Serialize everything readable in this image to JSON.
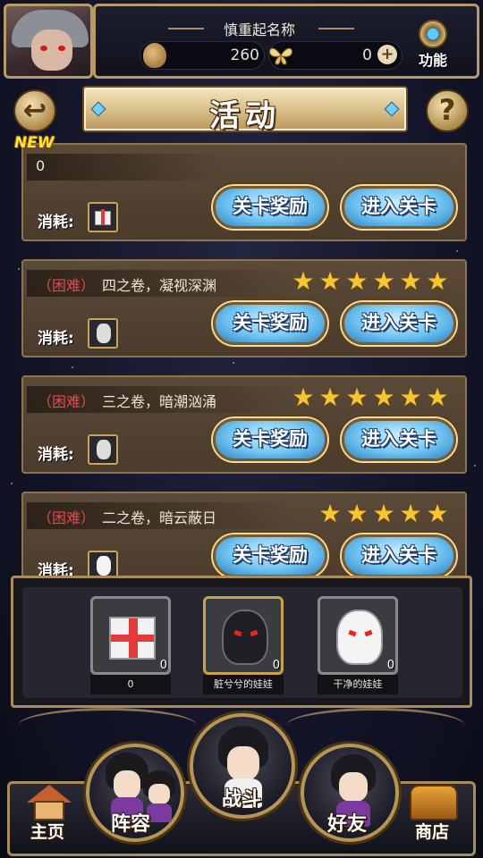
{
  "header": {
    "player_name": "慎重起名称",
    "currency_1": {
      "icon": "stone-icon",
      "value": "260"
    },
    "currency_2": {
      "icon": "butterfly-icon",
      "value": "0"
    },
    "add_label": "+",
    "settings_label": "功能"
  },
  "title_bar": {
    "back_label": "↩",
    "title": "活动",
    "help_label": "?"
  },
  "new_badge": "NEW",
  "cost_label": "消耗:",
  "buttons": {
    "reward": "关卡奖励",
    "enter": "进入关卡"
  },
  "stages": [
    {
      "name": "0",
      "difficulty": "",
      "stars": 0,
      "cost_icon": "gift-box-icon",
      "is_new": true
    },
    {
      "difficulty": "（困难）",
      "name": "四之卷，凝视深渊",
      "stars": 6,
      "cost_icon": "dark-doll-icon"
    },
    {
      "difficulty": "（困难）",
      "name": "三之卷，暗潮汹涌",
      "stars": 6,
      "cost_icon": "dark-doll-icon"
    },
    {
      "difficulty": "（困难）",
      "name": "二之卷，暗云蔽日",
      "stars": 5,
      "cost_icon": "white-doll-icon"
    }
  ],
  "inventory": [
    {
      "label": "0",
      "count": "0",
      "icon": "gift-box-icon",
      "selected": false
    },
    {
      "label": "脏兮兮的娃娃",
      "count": "0",
      "icon": "dark-doll-icon",
      "selected": true
    },
    {
      "label": "干净的娃娃",
      "count": "0",
      "icon": "white-doll-icon",
      "selected": false
    }
  ],
  "nav": {
    "home": "主页",
    "lineup": "阵容",
    "battle": "战斗",
    "friends": "好友",
    "shop": "商店"
  },
  "colors": {
    "frame_gold": "#b89a66",
    "button_blue": "#6ec3f2",
    "difficulty_red": "#e64a4a",
    "star_yellow": "#f6c531",
    "new_yellow": "#ffe23a"
  }
}
